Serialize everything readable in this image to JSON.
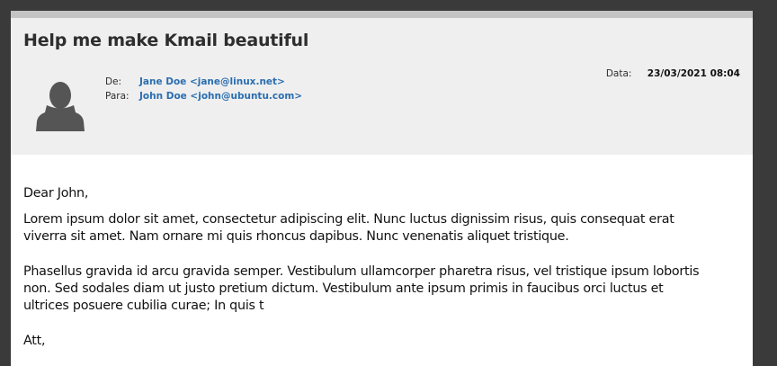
{
  "email": {
    "subject": "Help me make Kmail beautiful",
    "from_label": "De:",
    "from_value": "Jane Doe <jane@linux.net>",
    "to_label": "Para:",
    "to_value": "John Doe <john@ubuntu.com>",
    "date_label": "Data:",
    "date_value": "23/03/2021 08:04",
    "avatar_icon": "user-silhouette-icon",
    "body": {
      "greeting": "Dear John,",
      "paragraph1": "Lorem ipsum dolor sit amet, consectetur adipiscing elit. Nunc luctus dignissim risus, quis consequat erat viverra sit amet. Nam ornare mi quis rhoncus dapibus. Nunc venenatis aliquet tristique.",
      "paragraph2": "Phasellus gravida id arcu gravida semper. Vestibulum ullamcorper pharetra risus, vel tristique ipsum lobortis non. Sed sodales diam ut justo pretium dictum. Vestibulum ante ipsum primis in faucibus orci luctus et ultrices posuere cubilia curae; In quis t",
      "closing": "Att,"
    }
  },
  "colors": {
    "link": "#2a6eb0",
    "header_bg": "#efefef",
    "window_bg": "#3a3a3a"
  }
}
